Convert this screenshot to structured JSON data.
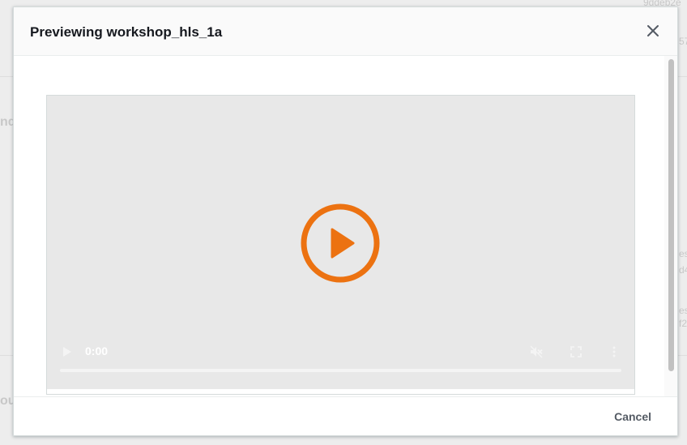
{
  "modal": {
    "title": "Previewing workshop_hls_1a",
    "close_icon": "close-icon",
    "cancel_label": "Cancel"
  },
  "player": {
    "time": "0:00",
    "progress": 0,
    "accent_color": "#ec7211",
    "icons": {
      "big_play": "play-circle-icon",
      "play": "play-icon",
      "mute": "volume-muted-icon",
      "fullscreen": "fullscreen-icon",
      "more": "more-vertical-icon"
    }
  },
  "background": {
    "fragments": [
      "nd",
      "ou",
      "9ddeb2e",
      "57",
      "es",
      "d4",
      "es",
      "f2"
    ]
  }
}
